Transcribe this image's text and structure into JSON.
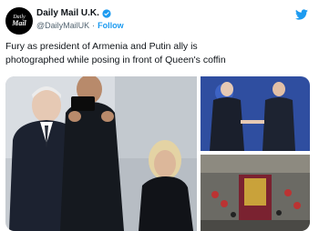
{
  "account": {
    "avatar_line1": "Daily",
    "avatar_line2": "Mail",
    "display_name": "Daily Mail U.K.",
    "handle": "@DailyMailUK",
    "separator": "·",
    "follow_label": "Follow"
  },
  "tweet": {
    "text_line1": "Fury as president of Armenia and Putin ally is",
    "text_line2": "photographed while posing in front of Queen's coffin"
  },
  "colors": {
    "brand": "#1d9bf0",
    "text": "#0f1419",
    "muted": "#536471"
  },
  "icons": {
    "verified": "verified-badge-icon",
    "logo": "twitter-bird-icon"
  }
}
